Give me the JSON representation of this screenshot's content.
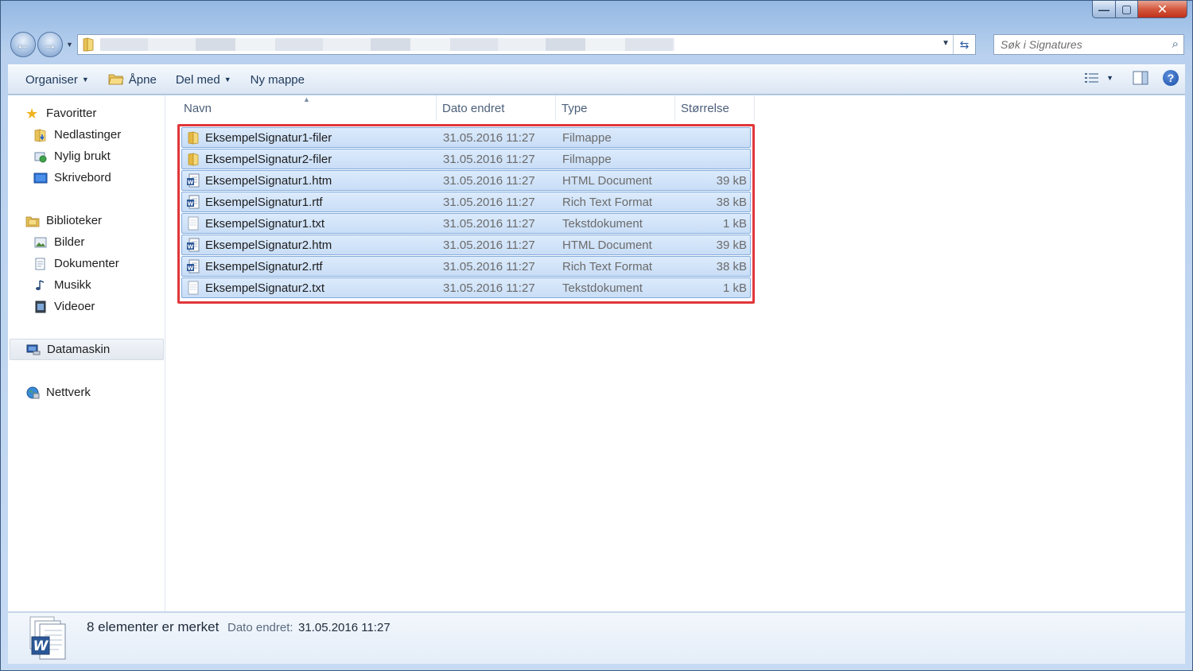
{
  "window": {
    "minimize_glyph": "—",
    "maximize_glyph": "▢",
    "close_glyph": "✕"
  },
  "address_bar": {
    "search_placeholder": "Søk i Signatures"
  },
  "toolbar": {
    "organize": "Organiser",
    "open": "Åpne",
    "share": "Del med",
    "new_folder": "Ny mappe"
  },
  "sidebar": {
    "favorites": {
      "label": "Favoritter",
      "items": [
        "Nedlastinger",
        "Nylig brukt",
        "Skrivebord"
      ]
    },
    "libraries": {
      "label": "Biblioteker",
      "items": [
        "Bilder",
        "Dokumenter",
        "Musikk",
        "Videoer"
      ]
    },
    "computer": "Datamaskin",
    "network": "Nettverk"
  },
  "columns": {
    "name": "Navn",
    "date": "Dato endret",
    "type": "Type",
    "size": "Størrelse"
  },
  "files": [
    {
      "name": "EksempelSignatur1-filer",
      "date": "31.05.2016 11:27",
      "type": "Filmappe",
      "size": "",
      "icon": "folder-icon"
    },
    {
      "name": "EksempelSignatur2-filer",
      "date": "31.05.2016 11:27",
      "type": "Filmappe",
      "size": "",
      "icon": "folder-icon"
    },
    {
      "name": "EksempelSignatur1.htm",
      "date": "31.05.2016 11:27",
      "type": "HTML Document",
      "size": "39 kB",
      "icon": "word-document-icon"
    },
    {
      "name": "EksempelSignatur1.rtf",
      "date": "31.05.2016 11:27",
      "type": "Rich Text Format",
      "size": "38 kB",
      "icon": "word-document-icon"
    },
    {
      "name": "EksempelSignatur1.txt",
      "date": "31.05.2016 11:27",
      "type": "Tekstdokument",
      "size": "1 kB",
      "icon": "text-document-icon"
    },
    {
      "name": "EksempelSignatur2.htm",
      "date": "31.05.2016 11:27",
      "type": "HTML Document",
      "size": "39 kB",
      "icon": "word-document-icon"
    },
    {
      "name": "EksempelSignatur2.rtf",
      "date": "31.05.2016 11:27",
      "type": "Rich Text Format",
      "size": "38 kB",
      "icon": "word-document-icon"
    },
    {
      "name": "EksempelSignatur2.txt",
      "date": "31.05.2016 11:27",
      "type": "Tekstdokument",
      "size": "1 kB",
      "icon": "text-document-icon"
    }
  ],
  "details": {
    "summary": "8 elementer er merket",
    "date_label": "Dato endret:",
    "date_value": "31.05.2016 11:27"
  },
  "colors": {
    "selection_bg": "#cfe2f8",
    "selection_border": "#84acdd",
    "highlight": "#e0373a",
    "word_blue": "#2b5797"
  }
}
